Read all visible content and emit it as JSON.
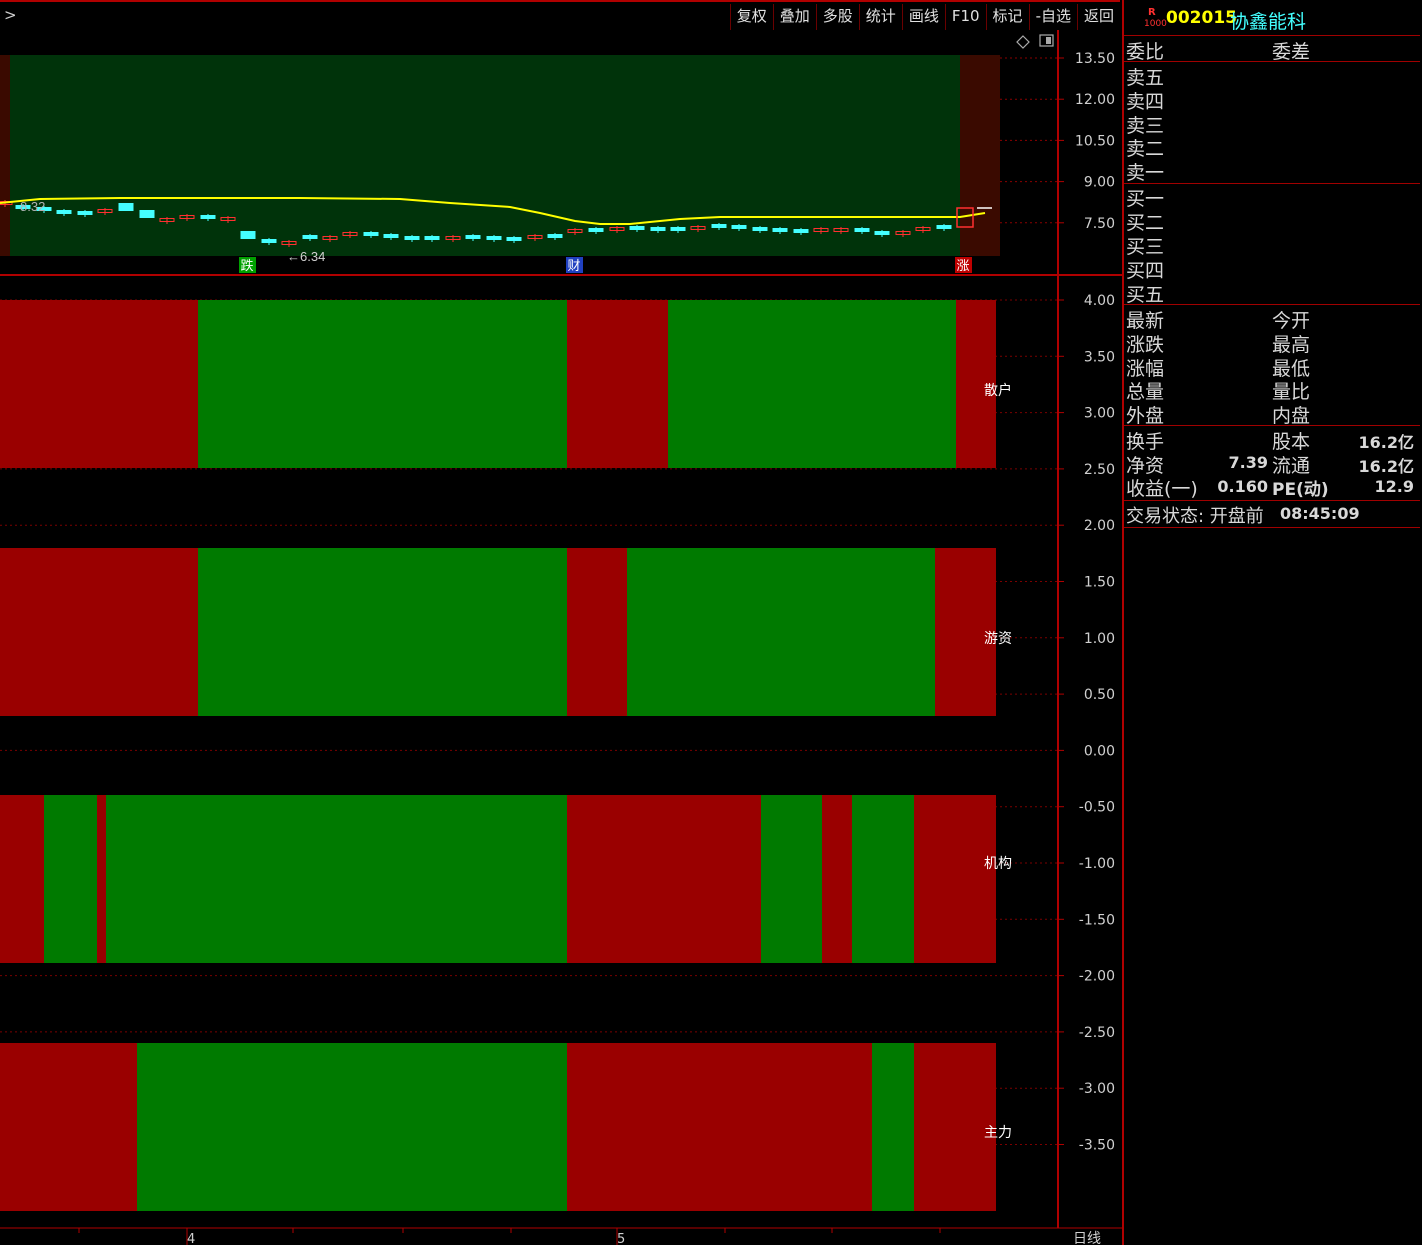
{
  "toolbar": {
    "expand_glyph": ">",
    "buttons": [
      "复权",
      "叠加",
      "多股",
      "统计",
      "画线",
      "F10",
      "标记",
      "-自选",
      "返回"
    ]
  },
  "stock": {
    "badge_top": "R",
    "badge_bottom": "1000",
    "code": "002015",
    "name": "协鑫能科"
  },
  "upper_chart": {
    "axis_labels": [
      "13.50",
      "12.00",
      "10.50",
      "9.00",
      "7.50"
    ],
    "low_label": "←6.34",
    "left_label": "8.32",
    "markers": [
      "跌",
      "财",
      "涨"
    ],
    "colors": {
      "up": "#ff3030",
      "down": "#44ffff",
      "ma": "#ffff00",
      "bg_green": "#00330a",
      "bg_red": "#3a0a00"
    }
  },
  "lower_chart": {
    "axis_labels": [
      "4.00",
      "3.50",
      "3.00",
      "2.50",
      "2.00",
      "1.50",
      "1.00",
      "0.50",
      "0.00",
      "-0.50",
      "-1.00",
      "-1.50",
      "-2.00",
      "-2.50",
      "-3.00",
      "-3.50"
    ],
    "rows": [
      {
        "label": "散户",
        "segments": [
          [
            "r",
            0,
            198
          ],
          [
            "g",
            198,
            567
          ],
          [
            "r",
            567,
            668
          ],
          [
            "g",
            668,
            956
          ],
          [
            "r",
            956,
            996
          ]
        ]
      },
      {
        "label": "游资",
        "segments": [
          [
            "r",
            0,
            198
          ],
          [
            "g",
            198,
            567
          ],
          [
            "r",
            567,
            627
          ],
          [
            "g",
            627,
            935
          ],
          [
            "r",
            935,
            996
          ]
        ]
      },
      {
        "label": "机构",
        "segments": [
          [
            "r",
            0,
            44
          ],
          [
            "g",
            44,
            97
          ],
          [
            "r",
            97,
            106
          ],
          [
            "g",
            106,
            567
          ],
          [
            "r",
            567,
            761
          ],
          [
            "g",
            761,
            822
          ],
          [
            "r",
            822,
            852
          ],
          [
            "g",
            852,
            914
          ],
          [
            "r",
            914,
            996
          ]
        ]
      },
      {
        "label": "主力",
        "segments": [
          [
            "r",
            0,
            137
          ],
          [
            "g",
            137,
            567
          ],
          [
            "r",
            567,
            872
          ],
          [
            "g",
            872,
            914
          ],
          [
            "r",
            914,
            996
          ]
        ]
      }
    ],
    "colors": {
      "red": "#9a0000",
      "green": "#007a00"
    }
  },
  "time_axis": {
    "labels": [
      "4",
      "5"
    ],
    "period": "日线"
  },
  "quote": {
    "weibi": "委比",
    "weicha": "委差",
    "sells": [
      "卖五",
      "卖四",
      "卖三",
      "卖二",
      "卖一"
    ],
    "buys": [
      "买一",
      "买二",
      "买三",
      "买四",
      "买五"
    ],
    "stats_left": [
      "最新",
      "涨跌",
      "涨幅",
      "总量",
      "外盘"
    ],
    "stats_right": [
      "今开",
      "最高",
      "最低",
      "量比",
      "内盘"
    ],
    "fin": [
      {
        "l1": "换手",
        "v1": "",
        "l2": "股本",
        "v2": "16.2亿"
      },
      {
        "l1": "净资",
        "v1": "7.39",
        "l2": "流通",
        "v2": "16.2亿"
      },
      {
        "l1": "收益(一)",
        "v1": "0.160",
        "l2": "PE(动)",
        "v2": "12.9"
      }
    ],
    "status_label": "交易状态: 开盘前",
    "status_time": "08:45:09"
  }
}
